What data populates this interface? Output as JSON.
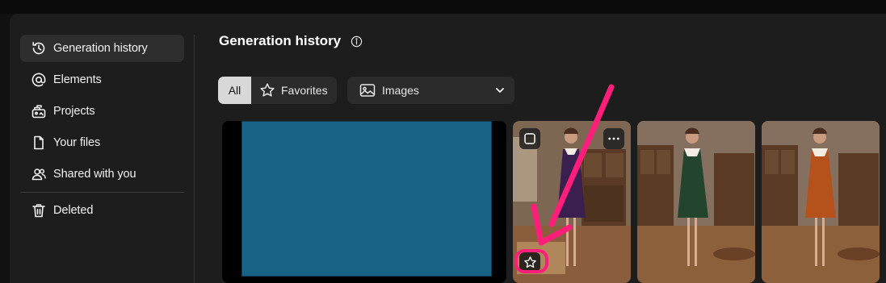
{
  "sidebar": {
    "items": [
      {
        "label": "Generation history",
        "icon": "history-icon",
        "active": true
      },
      {
        "label": "Elements",
        "icon": "at-sign-icon"
      },
      {
        "label": "Projects",
        "icon": "projects-icon"
      },
      {
        "label": "Your files",
        "icon": "file-icon"
      },
      {
        "label": "Shared with you",
        "icon": "shared-users-icon"
      }
    ],
    "deleted": {
      "label": "Deleted",
      "icon": "trash-icon"
    }
  },
  "main": {
    "title": "Generation history",
    "filters": {
      "all_label": "All",
      "favorites_label": "Favorites"
    },
    "dropdown": {
      "selected": "Images",
      "icon": "image-icon"
    }
  },
  "thumbnails": [
    {
      "kind": "placeholder",
      "color": "#196486"
    },
    {
      "kind": "photo",
      "dress_color": "#3b1f4f"
    },
    {
      "kind": "photo",
      "dress_color": "#23452e"
    },
    {
      "kind": "photo",
      "dress_color": "#b5521c"
    }
  ],
  "annotation": {
    "color": "#ff1e7a"
  },
  "colors": {
    "background": "#1d1d1d",
    "active": "#2e2e2e",
    "accent": "#ff1e7a"
  }
}
